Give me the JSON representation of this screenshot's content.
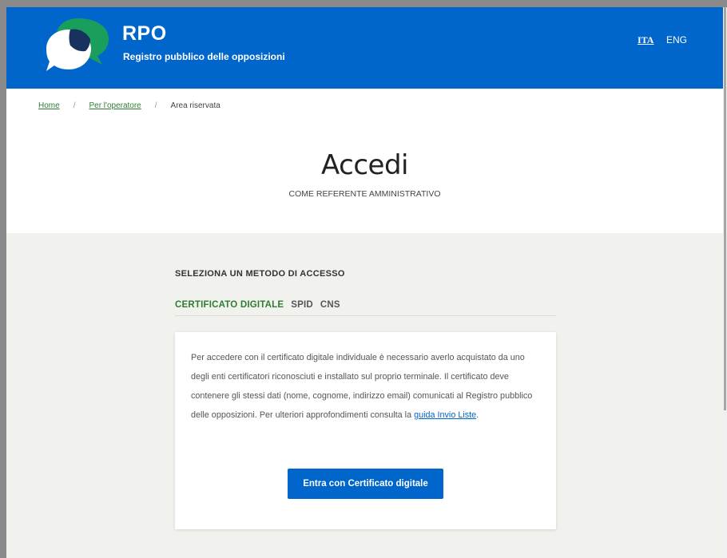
{
  "header": {
    "title": "RPO",
    "subtitle": "Registro pubblico delle opposizioni",
    "logo_icon": "speech-bubbles-logo-icon",
    "colors": {
      "primary": "#0066cc",
      "logo_green": "#1a9e5c",
      "logo_navy": "#17325f"
    },
    "languages": [
      {
        "label": "ITA",
        "active": true
      },
      {
        "label": "ENG",
        "active": false
      }
    ]
  },
  "breadcrumb": {
    "items": [
      {
        "label": "Home",
        "link": true
      },
      {
        "label": "Per l'operatore",
        "link": true
      },
      {
        "label": "Area riservata",
        "link": false
      }
    ],
    "separator": "/"
  },
  "hero": {
    "title": "Accedi",
    "subtitle": "COME REFERENTE AMMINISTRATIVO"
  },
  "access": {
    "heading": "SELEZIONA UN METODO DI ACCESSO",
    "tabs": [
      {
        "label": "CERTIFICATO DIGITALE",
        "active": true
      },
      {
        "label": "SPID",
        "active": false
      },
      {
        "label": "CNS",
        "active": false
      }
    ],
    "card": {
      "text_before_link": "Per accedere con il certificato digitale individuale è necessario averlo acquistato da uno degli enti certificatori riconosciuti e installato sul proprio terminale. Il certificato deve contenere gli stessi dati (nome, cognome, indirizzo email) comunicati al Registro pubblico delle opposizioni. Per ulteriori approfondimenti consulta la ",
      "link_text": "guida Invio Liste",
      "text_after_link": ".",
      "button_label": "Entra con Certificato digitale"
    }
  }
}
